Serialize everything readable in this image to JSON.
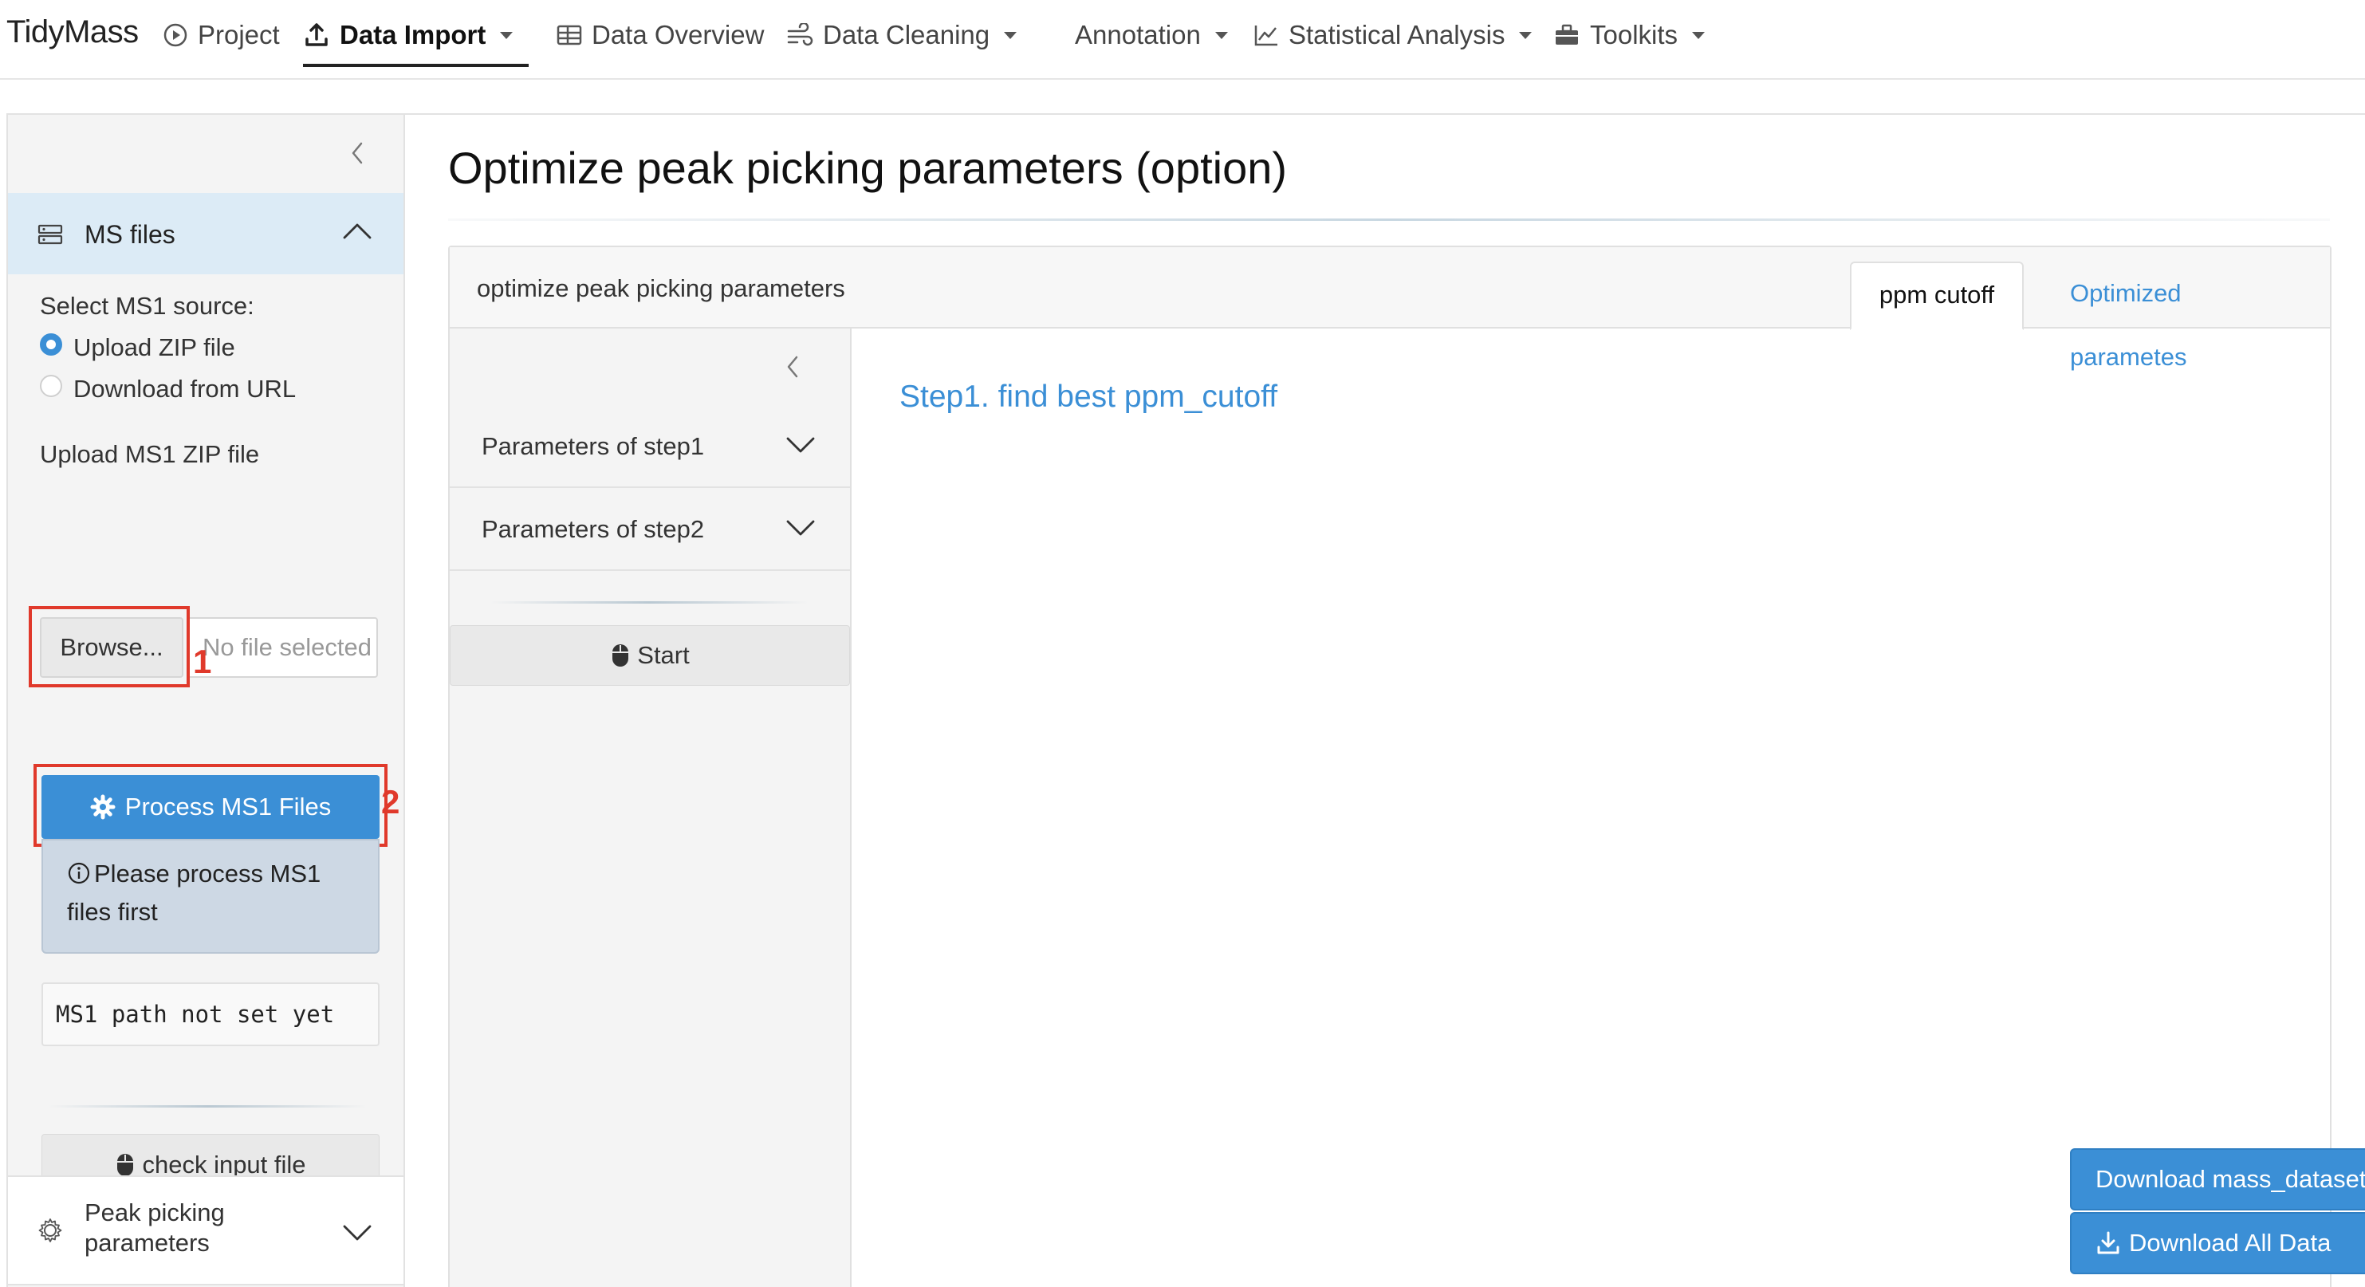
{
  "navbar": {
    "brand": "TidyMass",
    "items": [
      {
        "label": "Project",
        "icon": "play-circle-icon",
        "dropdown": false
      },
      {
        "label": "Data Import",
        "icon": "upload-icon",
        "dropdown": true,
        "active": true
      },
      {
        "label": "Data Overview",
        "icon": "table-icon",
        "dropdown": false
      },
      {
        "label": "Data Cleaning",
        "icon": "wind-icon",
        "dropdown": true
      },
      {
        "label": "Annotation",
        "icon": "",
        "dropdown": true
      },
      {
        "label": "Statistical Analysis",
        "icon": "chart-line-icon",
        "dropdown": true
      },
      {
        "label": "Toolkits",
        "icon": "toolbox-icon",
        "dropdown": true
      }
    ]
  },
  "sidebar": {
    "section_label": "MS files",
    "source_label": "Select MS1 source:",
    "source_options": [
      "Upload ZIP file",
      "Download from URL"
    ],
    "selected_source": "Upload ZIP file",
    "upload_label": "Upload MS1 ZIP file",
    "browse_label": "Browse...",
    "file_placeholder": "No file selected",
    "marker_1": "1",
    "marker_2": "2",
    "process_label": "Process MS1 Files",
    "info_text": "Please process MS1 files first",
    "path_text": "MS1 path not set yet",
    "check_label": "check input file",
    "peak_label": "Peak picking parameters"
  },
  "main": {
    "page_title": "Optimize peak picking parameters (option)",
    "card_title": "optimize peak picking parameters",
    "tabs": [
      "ppm cutoff",
      "Optimized parametes"
    ],
    "active_tab": "ppm cutoff",
    "inner": {
      "accordions": [
        "Parameters of step1",
        "Parameters of step2"
      ],
      "start_label": "Start"
    },
    "step_heading": "Step1. find best ppm_cutoff"
  },
  "downloads": {
    "mass_dataset_label": "Download mass_dataset",
    "all_label": "Download All Data"
  },
  "colors": {
    "accent": "#3b8fd6",
    "highlight": "#e0392b",
    "sidebar_header_bg": "#dcebf6",
    "info_bg": "#cdd8e4"
  }
}
